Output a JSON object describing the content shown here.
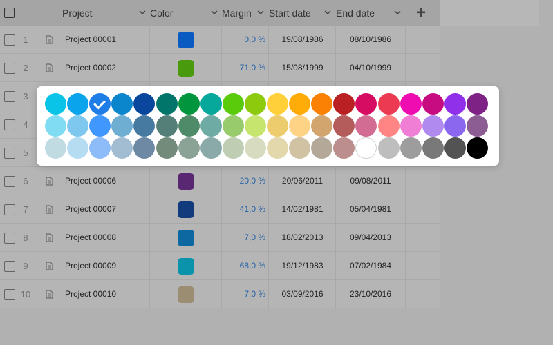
{
  "columns": {
    "project": "Project",
    "color": "Color",
    "margin": "Margin",
    "start_date": "Start date",
    "end_date": "End date",
    "add": "+"
  },
  "rows": [
    {
      "num": "1",
      "name": "Project 00001",
      "color": "#0a5bc1",
      "margin": "0,0 %",
      "start": "19/08/1986",
      "end": "08/10/1986"
    },
    {
      "num": "2",
      "name": "Project 00002",
      "color": "#4a9a0d",
      "margin": "71,0 %",
      "start": "15/08/1999",
      "end": "04/10/1999"
    },
    {
      "num": "3",
      "name": "",
      "color": "",
      "margin": "",
      "start": "",
      "end": ""
    },
    {
      "num": "4",
      "name": "",
      "color": "",
      "margin": "",
      "start": "",
      "end": ""
    },
    {
      "num": "5",
      "name": "",
      "color": "",
      "margin": "",
      "start": "",
      "end": ""
    },
    {
      "num": "6",
      "name": "Project 00006",
      "color": "#5a2772",
      "margin": "20,0 %",
      "start": "20/06/2011",
      "end": "09/08/2011"
    },
    {
      "num": "7",
      "name": "Project 00007",
      "color": "#113b7c",
      "margin": "41,0 %",
      "start": "14/02/1981",
      "end": "05/04/1981"
    },
    {
      "num": "8",
      "name": "Project 00008",
      "color": "#0d67a0",
      "margin": "7,0 %",
      "start": "18/02/2013",
      "end": "09/04/2013"
    },
    {
      "num": "9",
      "name": "Project 00009",
      "color": "#0a93aa",
      "margin": "68,0 %",
      "start": "19/12/1983",
      "end": "07/02/1984"
    },
    {
      "num": "10",
      "name": "Project 00010",
      "color": "#9b8d72",
      "margin": "7,0 %",
      "start": "03/09/2016",
      "end": "23/10/2016"
    }
  ],
  "palette": {
    "selected": "#1e7de6",
    "rows": [
      [
        "#09c4e6",
        "#0aa4ec",
        "#1e7de6",
        "#0b85cb",
        "#0b469d",
        "#017569",
        "#01953e",
        "#06a89b",
        "#5acb0b",
        "#8dc90c",
        "#ffd03a",
        "#ffac09",
        "#fb8104",
        "#b91f23",
        "#d60c62",
        "#ec3a52",
        "#ef0cb0",
        "#c70c81",
        "#9030ea",
        "#7f2286"
      ],
      [
        "#7fdcf2",
        "#7ec8f0",
        "#4098ff",
        "#6daed2",
        "#467aa1",
        "#537f78",
        "#4f8b69",
        "#6eaba4",
        "#97cb6c",
        "#c5e56e",
        "#edcc6d",
        "#ffd386",
        "#d2a56f",
        "#b45b5b",
        "#d26c92",
        "#ff8585",
        "#f07ed4",
        "#b08aee",
        "#8b67f0",
        "#8b5d92"
      ],
      [
        "#c0dce2",
        "#b6dcf1",
        "#8dbcf8",
        "#a2bdd2",
        "#6e89a4",
        "#728b7b",
        "#8ba396",
        "#89aaa8",
        "#bfcdb3",
        "#d7dcc0",
        "#e3d8ab",
        "#d1c2a4",
        "#b4a898",
        "#bc8e8e",
        "#ffffff",
        "#bebebe",
        "#9d9d9d",
        "#797979",
        "#535353",
        "#000000"
      ]
    ]
  }
}
